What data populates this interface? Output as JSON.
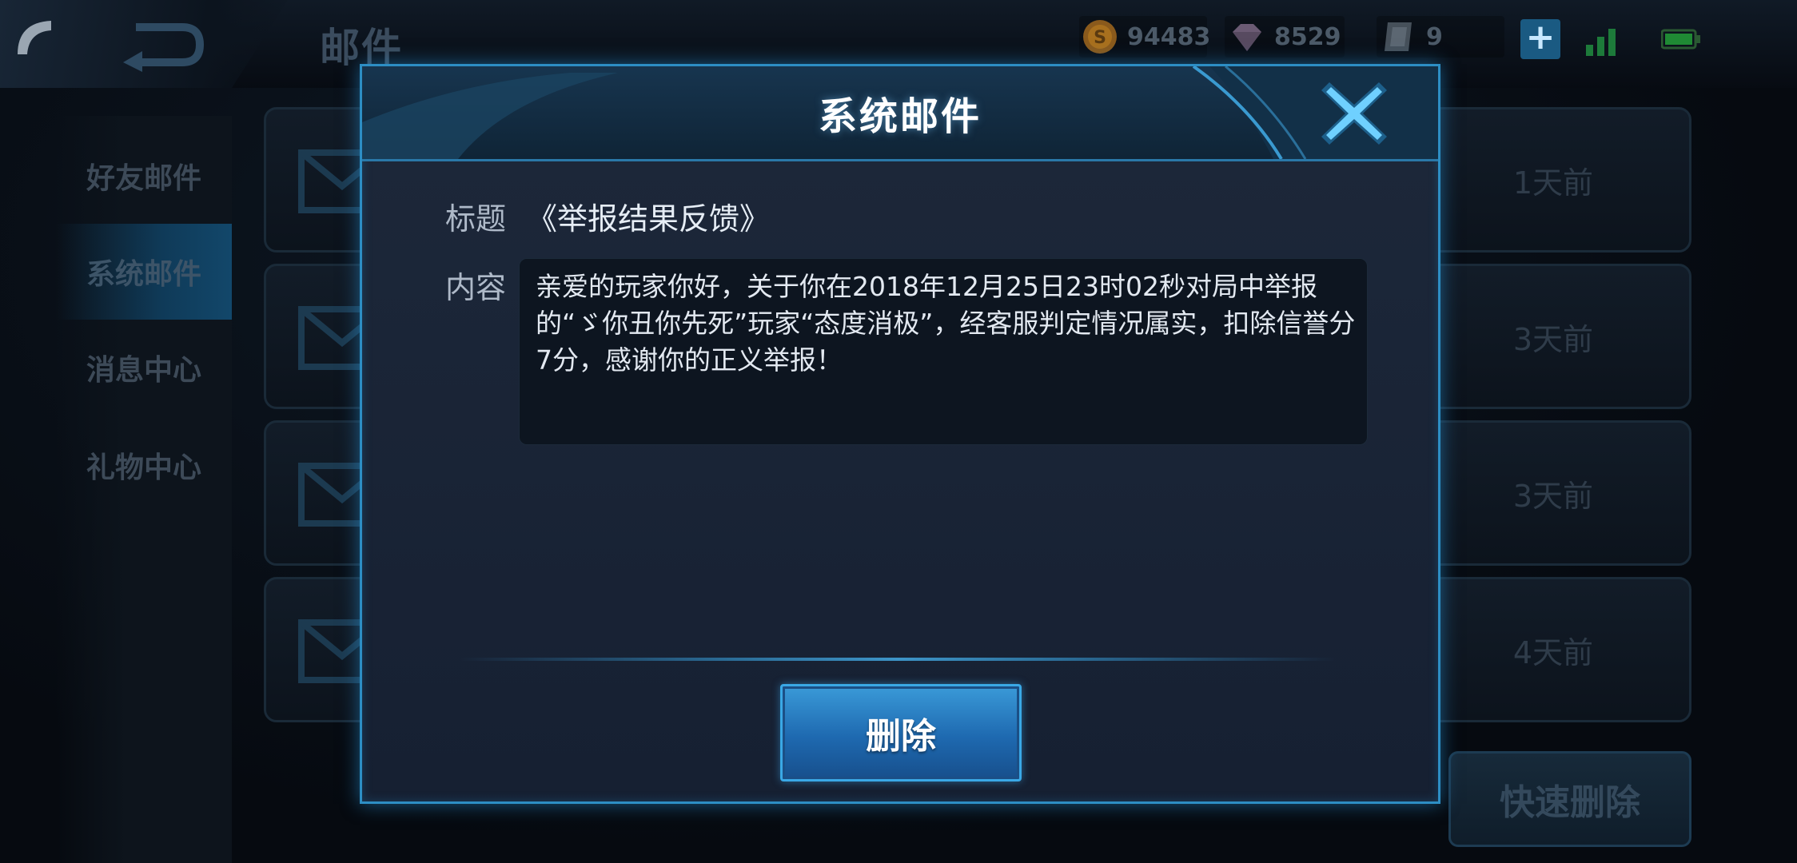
{
  "header": {
    "title": "邮件",
    "gold": "94483",
    "diamonds": "8529",
    "tickets": "9"
  },
  "sidebar": {
    "items": [
      {
        "label": "好友邮件"
      },
      {
        "label": "系统邮件"
      },
      {
        "label": "消息中心"
      },
      {
        "label": "礼物中心"
      }
    ],
    "active_index": 1
  },
  "mail_list": [
    {
      "time": "1天前"
    },
    {
      "time": "3天前"
    },
    {
      "time": "3天前"
    },
    {
      "time": "4天前"
    }
  ],
  "quick_delete_label": "快速删除",
  "dialog": {
    "title": "系统邮件",
    "subject_label": "标题",
    "subject_value": "《举报结果反馈》",
    "content_label": "内容",
    "content_text": "亲爱的玩家你好，关于你在2018年12月25日23时02秒对局中举报的“ゞ你丑你先死”玩家“态度消极”，经客服判定情况属实，扣除信誉分7分，感谢你的正义举报！",
    "delete_label": "删除"
  },
  "icons": {
    "back": "back-arrow-icon",
    "phone": "phone-icon",
    "gold": "gold-coin-icon",
    "diamond": "diamond-icon",
    "ticket": "ticket-icon",
    "plus": "plus-icon",
    "signal": "signal-icon",
    "battery": "battery-icon",
    "close": "close-x-icon",
    "envelope": "envelope-icon"
  },
  "colors": {
    "accent": "#2d8ec4",
    "button": "#1e69b0",
    "dialog_bg": "#1d283a"
  }
}
